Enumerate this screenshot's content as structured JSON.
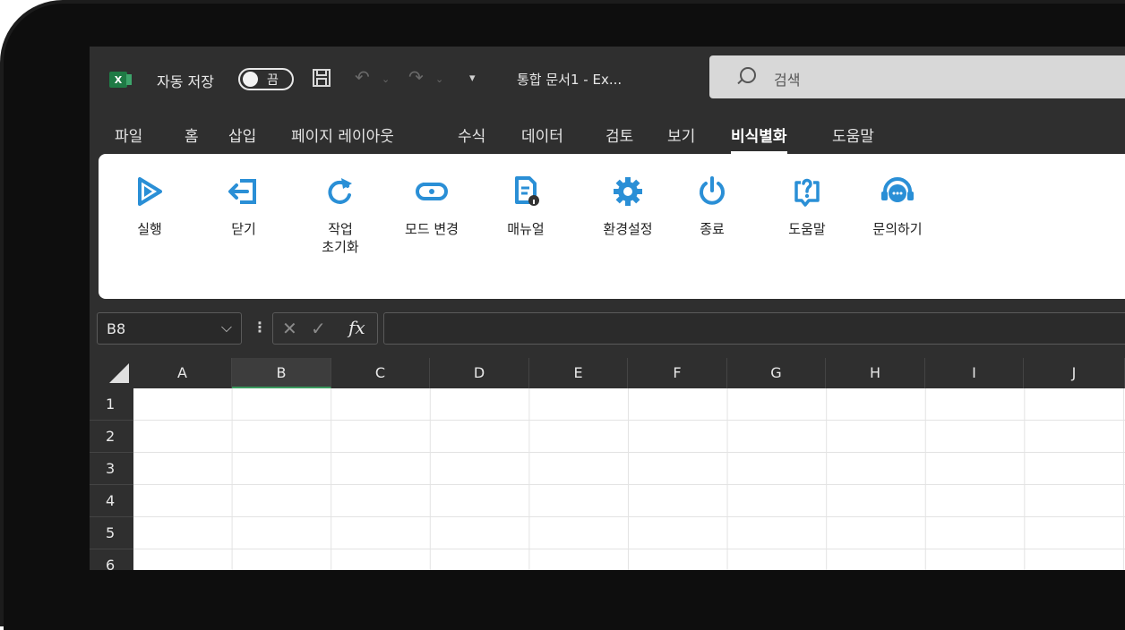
{
  "titlebar": {
    "app_logo": "X",
    "autosave_label": "자동 저장",
    "autosave_state": "끔",
    "doc_title": "통합 문서1 - Ex...",
    "search_placeholder": "검색"
  },
  "menu": {
    "tabs": [
      "파일",
      "홈",
      "삽입",
      "페이지 레이아웃",
      "수식",
      "데이터",
      "검토",
      "보기",
      "비식별화",
      "도움말"
    ],
    "active_tab": "비식별화"
  },
  "ribbon": {
    "accent_color": "#2a8fd6",
    "buttons": [
      {
        "label": "실행",
        "icon": "play-icon"
      },
      {
        "label": "닫기",
        "icon": "exit-icon"
      },
      {
        "label": "작업\n초기화",
        "icon": "reset-icon"
      },
      {
        "label": "모드 변경",
        "icon": "mode-switch-icon"
      },
      {
        "label": "매뉴얼",
        "icon": "manual-icon"
      },
      {
        "label": "환경설정",
        "icon": "gear-icon"
      },
      {
        "label": "종료",
        "icon": "power-icon"
      },
      {
        "label": "도움말",
        "icon": "help-icon"
      },
      {
        "label": "문의하기",
        "icon": "headset-icon"
      }
    ]
  },
  "formula_bar": {
    "name_box": "B8",
    "fx_label": "fx",
    "formula": ""
  },
  "grid": {
    "columns": [
      "A",
      "B",
      "C",
      "D",
      "E",
      "F",
      "G",
      "H",
      "I",
      "J"
    ],
    "selected_column": "B",
    "rows": [
      "1",
      "2",
      "3",
      "4",
      "5",
      "6"
    ]
  }
}
